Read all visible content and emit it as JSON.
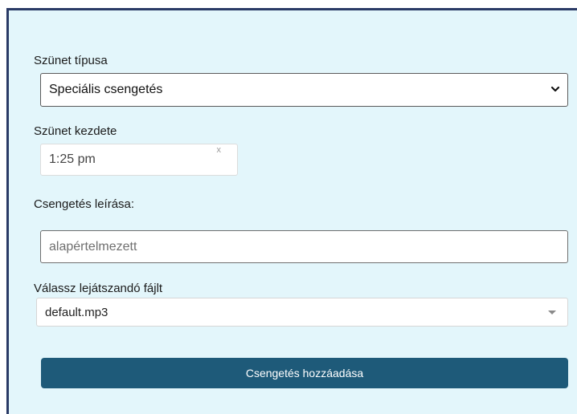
{
  "form": {
    "break_type": {
      "label": "Szünet típusa",
      "selected": "Speciális csengetés",
      "icon": "chevron-down-icon"
    },
    "break_start": {
      "label": "Szünet kezdete",
      "value": "1:25 pm",
      "clear_glyph": "x"
    },
    "description": {
      "label": "Csengetés leírása:",
      "placeholder": "alapértelmezett"
    },
    "file": {
      "label": "Válassz lejátszandó fájlt",
      "selected": "default.mp3",
      "icon": "caret-down-icon"
    },
    "submit_label": "Csengetés hozzáadása"
  },
  "colors": {
    "panel_bg": "#e3f6fb",
    "panel_border": "#2a3a66",
    "button_bg": "#1e5a79",
    "button_text": "#ffffff"
  }
}
